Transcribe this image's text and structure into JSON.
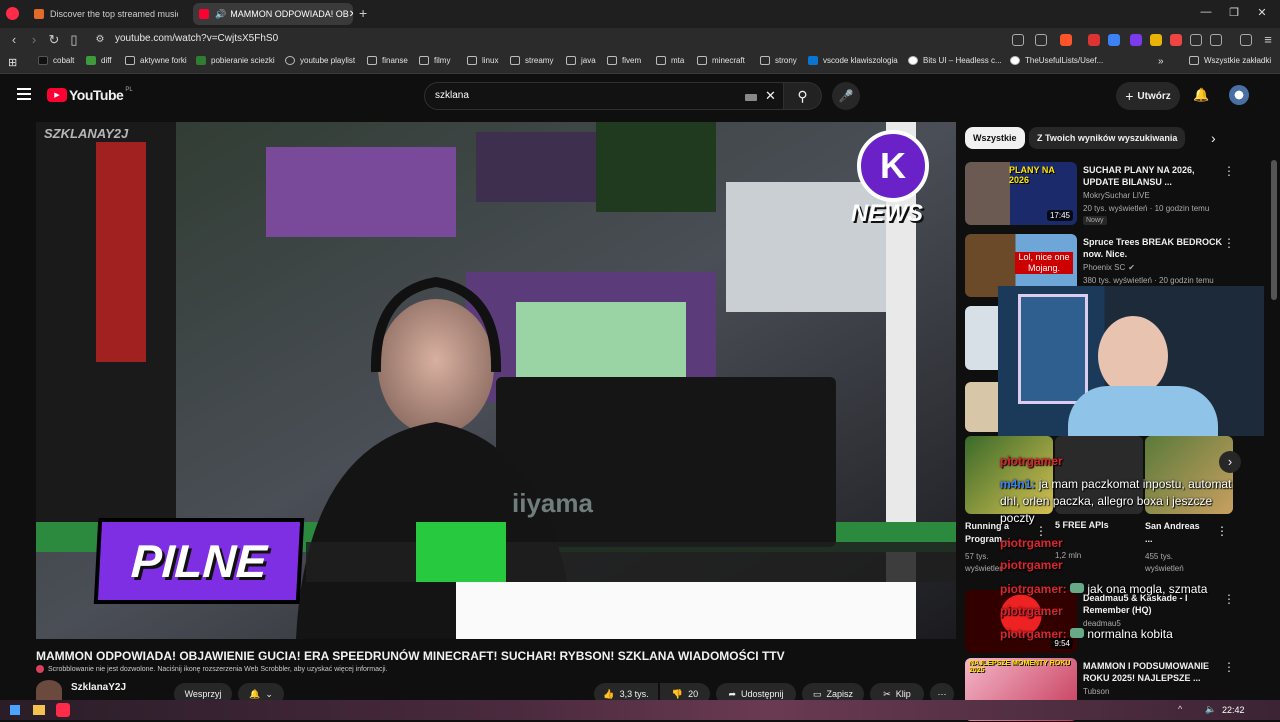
{
  "tabs": [
    {
      "label": "Discover the top streamed music",
      "fav_color": "#e26b2a"
    },
    {
      "label": "MAMMON ODPOWIADA! OB",
      "fav_color": "#ff0033"
    }
  ],
  "address": {
    "url": "youtube.com/watch?v=CwjtsX5FhS0"
  },
  "bookmarks": [
    "cobalt",
    "diff",
    "aktywne forki",
    "pobieranie sciezki",
    "youtube playlist",
    "finanse",
    "filmy",
    "linux",
    "streamy",
    "java",
    "fivem",
    "mta",
    "minecraft",
    "strony",
    "vscode klawiszologia",
    "Bits UI – Headless c...",
    "TheUsefulLists/Usef...",
    "Wszystkie zakładki"
  ],
  "youtube": {
    "logo_text": "YouTube",
    "logo_region": "PL",
    "search_value": "szklana",
    "create_label": "Utwórz"
  },
  "player": {
    "watermark": "SZKLANAY2J",
    "badge_text": "PILNE",
    "news_logo_text": "NEWS",
    "monitor_brand": "iiyama"
  },
  "video": {
    "title": "MAMMON ODPOWIADA! OBJAWIENIE GUCIA! ERA SPEEDRUNÓW MINECRAFT! SUCHAR! RYBSON! SZKLANA WIADOMOŚCI TTV",
    "scrobbler_note": "Scrobblowanie nie jest dozwolone. Naciśnij ikonę rozszerzenia Web Scrobbler, aby uzyskać więcej informacji.",
    "channel": "SzklanaY2J",
    "support_label": "Wesprzyj",
    "likes": "3,3 tys.",
    "comments": "20",
    "share_label": "Udostępnij",
    "save_label": "Zapisz",
    "clip_label": "Klip"
  },
  "sidebar": {
    "chips": [
      "Wszystkie",
      "Z Twoich wyników wyszukiwania"
    ],
    "videos": [
      {
        "title": "SUCHAR PLANY NA 2026, UPDATE BILANSU ...",
        "channel": "MokrySuchar LIVE",
        "meta": "20 tys. wyświetleń · 10 godzin temu",
        "badge": "Nowy",
        "duration": "17:45",
        "thumb_text": "PLANY NA 2026"
      },
      {
        "title": "Spruce Trees BREAK BEDROCK now. Nice.",
        "channel": "Phoenix SC",
        "meta": "380 tys. wyświetleń · 20 godzin temu",
        "thumb_text": "Lol, nice one Mojang."
      },
      {
        "title": "Running a Program...",
        "meta_views": "57 tys. wyświetleń"
      },
      {
        "title": "5 FREE APIs",
        "meta_views": "1,2 mln"
      },
      {
        "title": "San Andreas ...",
        "meta_views": "455 tys. wyświetleń"
      },
      {
        "title": "Deadmau5 & Kaskade - I Remember (HQ)",
        "channel": "deadmau5",
        "duration": "9:54"
      },
      {
        "title": "MAMMON I PODSUMOWANIE ROKU 2025! NAJLEPSZE ...",
        "channel": "Tubson",
        "thumb_text": "NAJLEPSZE MOMENTY ROKU 2025"
      }
    ]
  },
  "chat_overlay": [
    {
      "name": "piotrgamer",
      "text": ""
    },
    {
      "name": "m4n1:",
      "text": "ja mam paczkomat inpostu, automat dhl, orlen paczka, allegro boxa i jeszcze poczty"
    },
    {
      "name": "piotrgamer",
      "text": ""
    },
    {
      "name": "piotrgamer",
      "text": ""
    },
    {
      "name": "piotrgamer:",
      "text": "jak ona mogla, szmata"
    },
    {
      "name": "piotrgamer",
      "text": ""
    },
    {
      "name": "piotrgamer:",
      "text": "normalna kobita"
    }
  ],
  "taskbar": {
    "time": "22:42"
  }
}
